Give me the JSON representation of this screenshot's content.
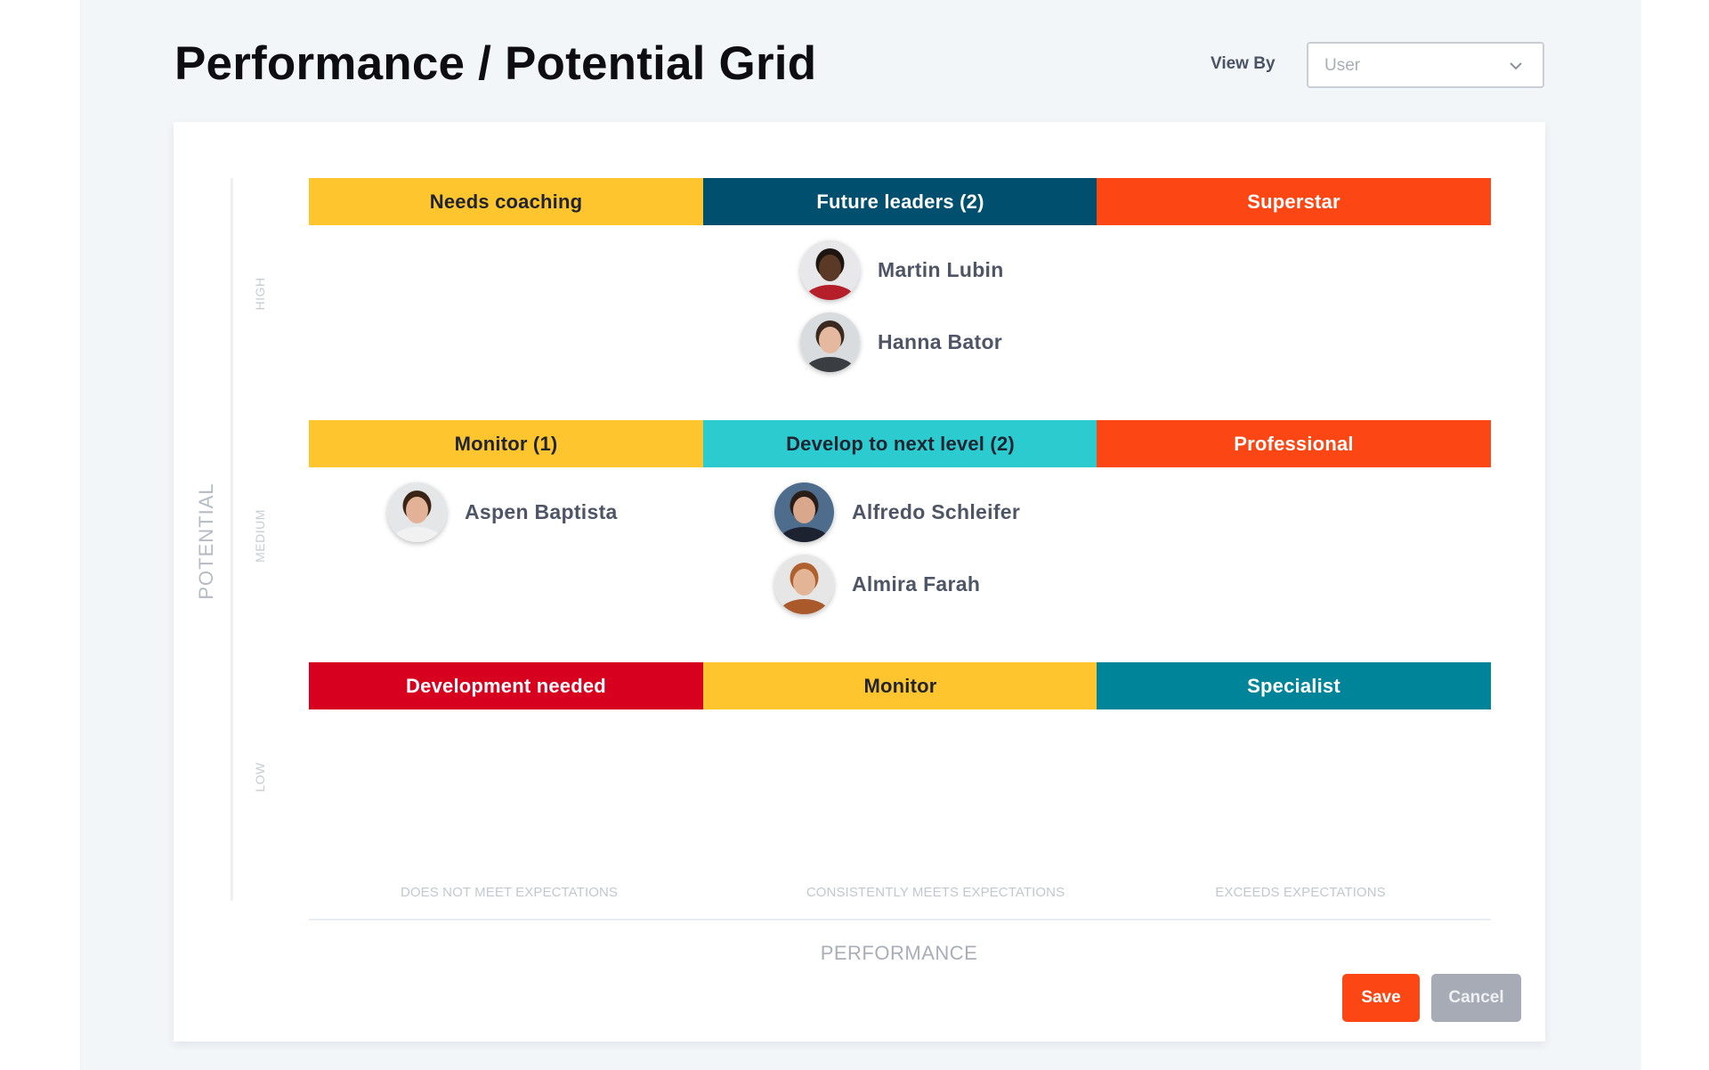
{
  "page": {
    "title": "Performance / Potential Grid",
    "view_by": {
      "label": "View By",
      "selected": "User",
      "icon": "chevron-down-icon"
    }
  },
  "grid": {
    "y_axis_label": "POTENTIAL",
    "x_axis_label": "PERFORMANCE",
    "rows": [
      {
        "label": "HIGH",
        "cells": [
          {
            "title": "Needs coaching",
            "color": "#fec52e",
            "text_color": "#1f2430",
            "people": []
          },
          {
            "title": "Future leaders (2)",
            "color": "#014f6e",
            "text_color": "#ffffff",
            "people": [
              {
                "name": "Martin Lubin",
                "avatar": "martin"
              },
              {
                "name": "Hanna Bator",
                "avatar": "hanna"
              }
            ]
          },
          {
            "title": "Superstar",
            "color": "#fc4614",
            "text_color": "#ffffff",
            "people": []
          }
        ]
      },
      {
        "label": "MEDIUM",
        "cells": [
          {
            "title": "Monitor (1)",
            "color": "#fec52e",
            "text_color": "#1f2430",
            "people": [
              {
                "name": "Aspen Baptista",
                "avatar": "aspen"
              }
            ]
          },
          {
            "title": "Develop to next level (2)",
            "color": "#2ccbd0",
            "text_color": "#1f2430",
            "people": [
              {
                "name": "Alfredo Schleifer",
                "avatar": "alfredo"
              },
              {
                "name": "Almira Farah",
                "avatar": "almira"
              }
            ]
          },
          {
            "title": "Professional",
            "color": "#fc4614",
            "text_color": "#ffffff",
            "people": []
          }
        ]
      },
      {
        "label": "LOW",
        "cells": [
          {
            "title": "Development needed",
            "color": "#d7001e",
            "text_color": "#ffffff",
            "people": []
          },
          {
            "title": "Monitor",
            "color": "#fec52e",
            "text_color": "#1f2430",
            "people": []
          },
          {
            "title": "Specialist",
            "color": "#00849a",
            "text_color": "#ffffff",
            "people": []
          }
        ]
      }
    ],
    "columns": [
      "DOES NOT MEET EXPECTATIONS",
      "CONSISTENTLY MEETS EXPECTATIONS",
      "EXCEEDS EXPECTATIONS"
    ]
  },
  "actions": {
    "save": "Save",
    "cancel": "Cancel"
  },
  "colors": {
    "accent": "#fc4614",
    "cancel": "#a6abb5"
  }
}
